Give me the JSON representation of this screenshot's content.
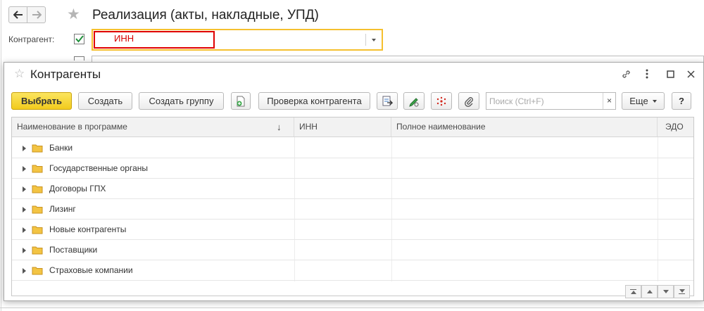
{
  "document": {
    "title": "Реализация (акты, накладные, УПД)",
    "kontragent_label": "Контрагент:",
    "kontragent_value": "ИНН"
  },
  "popup": {
    "title": "Контрагенты",
    "toolbar": {
      "choose": "Выбрать",
      "create": "Создать",
      "create_group": "Создать группу",
      "check_contractor": "Проверка контрагента",
      "more": "Еще",
      "help": "?",
      "search_placeholder": "Поиск (Ctrl+F)",
      "search_value": "",
      "search_clear": "×"
    },
    "table": {
      "columns": [
        "Наименование в программе",
        "ИНН",
        "Полное наименование",
        "ЭДО"
      ],
      "rows": [
        {
          "name": "Банки"
        },
        {
          "name": "Государственные органы"
        },
        {
          "name": "Договоры ГПХ"
        },
        {
          "name": "Лизинг"
        },
        {
          "name": "Новые контрагенты"
        },
        {
          "name": "Поставщики"
        },
        {
          "name": "Страховые компании"
        }
      ]
    }
  },
  "colors": {
    "accent_yellow": "#f2cb1d",
    "highlight_red": "#e00000",
    "field_border_yellow": "#f5c02e",
    "check_green": "#1e8f3a",
    "folder_yellow": "#f3c443"
  },
  "icons": {
    "back": "arrow-left-icon",
    "forward": "arrow-right-icon",
    "favorite": "star-icon",
    "link": "link-icon",
    "menu": "more-vertical-icon",
    "maximize": "maximize-icon",
    "close": "close-icon",
    "folder": "folder-icon"
  }
}
